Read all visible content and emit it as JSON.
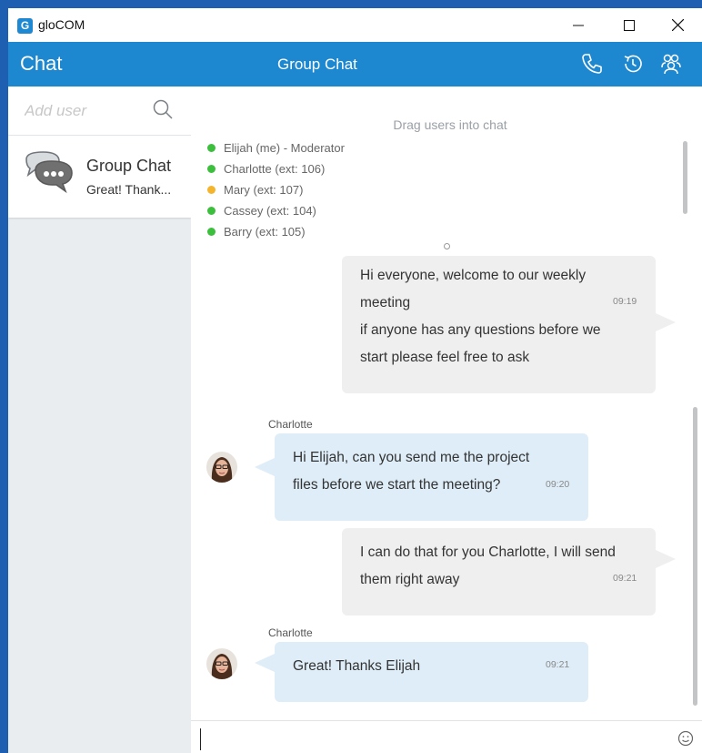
{
  "window": {
    "title": "gloCOM",
    "app_icon_letter": "G"
  },
  "header": {
    "section": "Chat",
    "title": "Group Chat",
    "icons": [
      "phone-icon",
      "history-icon",
      "participants-icon"
    ]
  },
  "sidebar": {
    "search_placeholder": "Add user",
    "chats": [
      {
        "name": "Group Chat",
        "preview": "Great! Thank..."
      }
    ]
  },
  "main": {
    "drag_hint": "Drag users into chat",
    "participants": [
      {
        "label": "Elijah (me) - Moderator",
        "status_color": "#3cbf3c"
      },
      {
        "label": "Charlotte (ext: 106)",
        "status_color": "#3cbf3c"
      },
      {
        "label": "Mary (ext: 107)",
        "status_color": "#f4b42b"
      },
      {
        "label": "Cassey (ext: 104)",
        "status_color": "#3cbf3c"
      },
      {
        "label": "Barry (ext: 105)",
        "status_color": "#3cbf3c"
      }
    ],
    "messages": [
      {
        "direction": "outgoing",
        "lines": [
          "Hi everyone, welcome to our weekly",
          "meeting",
          "if anyone has any questions before we",
          "start please feel free to ask"
        ],
        "time": "09:19"
      },
      {
        "direction": "incoming",
        "sender": "Charlotte",
        "lines": [
          "Hi Elijah, can you send me the project",
          "files before we start the meeting?"
        ],
        "time": "09:20"
      },
      {
        "direction": "outgoing",
        "lines": [
          "I can do that for you Charlotte, I will send",
          "them right away"
        ],
        "time": "09:21"
      },
      {
        "direction": "incoming",
        "sender": "Charlotte",
        "lines": [
          "Great! Thanks Elijah"
        ],
        "time": "09:21"
      }
    ]
  },
  "composer": {
    "value": ""
  },
  "colors": {
    "brand": "#1d87cf",
    "outgoing_bubble": "#efefef",
    "incoming_bubble": "#deedf7"
  }
}
